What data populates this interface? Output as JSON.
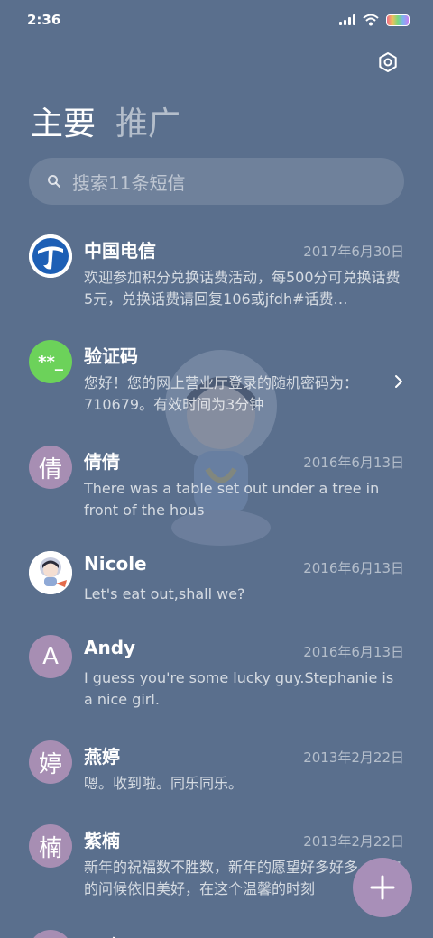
{
  "status": {
    "time": "2:36"
  },
  "tabs": [
    "主要",
    "推广"
  ],
  "search": {
    "placeholder": "搜索11条短信"
  },
  "messages": [
    {
      "name": "中国电信",
      "date": "2017年6月30日",
      "preview": "欢迎参加积分兑换话费活动，每500分可兑换话费5元，兑换话费请回复106或jfdh#话费…",
      "avatar": "telecom-logo"
    },
    {
      "name": "验证码",
      "date": "",
      "preview": "您好！您的网上营业厅登录的随机密码为：710679。有效时间为3分钟",
      "avatar_text": "**_"
    },
    {
      "name": "倩倩",
      "date": "2016年6月13日",
      "preview": "There was a table set out under a tree in front of the hous",
      "avatar_text": "倩"
    },
    {
      "name": "Nicole",
      "date": "2016年6月13日",
      "preview": "Let's eat out,shall we?",
      "avatar": "illustrated-girl"
    },
    {
      "name": "Andy",
      "date": "2016年6月13日",
      "preview": "I guess you're some lucky guy.Stephanie is a nice girl.",
      "avatar_text": "A"
    },
    {
      "name": "燕婷",
      "date": "2013年2月22日",
      "preview": "嗯。收到啦。同乐同乐。",
      "avatar_text": "婷"
    },
    {
      "name": "紫楠",
      "date": "2013年2月22日",
      "preview": "新年的祝福数不胜数，新年的愿望好多好多，新年的问候依旧美好，在这个温馨的时刻",
      "avatar_text": "楠"
    },
    {
      "name": "子玲",
      "date": "",
      "preview": "",
      "avatar_text": ""
    }
  ],
  "colors": {
    "background": "#5a6f8d",
    "avatar_purple": "#a78eb3",
    "avatar_green": "#6cd25a",
    "fab": "#a88fb8"
  }
}
